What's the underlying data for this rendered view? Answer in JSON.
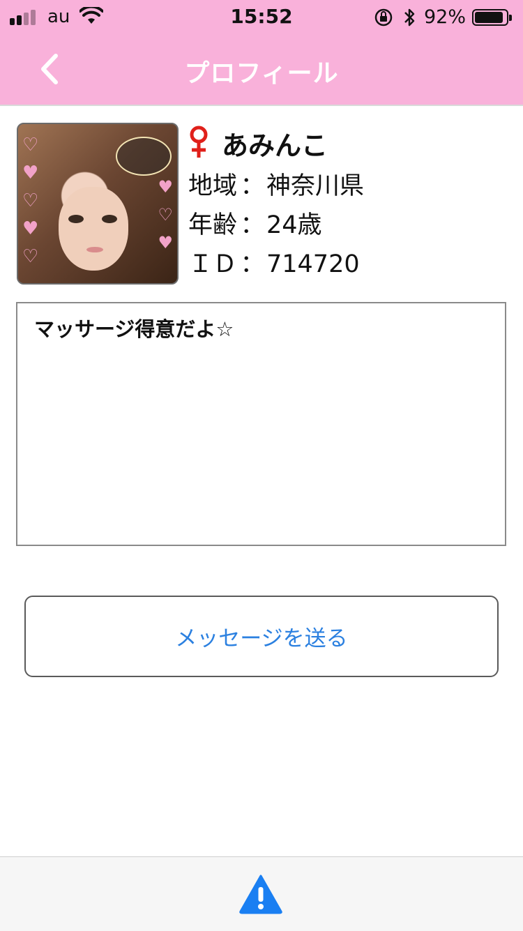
{
  "status_bar": {
    "carrier": "au",
    "time": "15:52",
    "battery_percent": "92%",
    "battery_level": 0.92,
    "signal_bars_filled": 2,
    "signal_bars_total": 4,
    "icons": [
      "signal-icon",
      "wifi-icon",
      "rotation-lock-icon",
      "bluetooth-icon",
      "battery-icon"
    ]
  },
  "nav": {
    "title": "プロフィール",
    "back_icon": "chevron-left-icon",
    "background_color": "#f9b1da"
  },
  "profile": {
    "gender_symbol": "♀",
    "gender_icon": "female-icon",
    "gender_color": "#e0201a",
    "name": "あみんこ",
    "region_label": "地域",
    "region_value": "神奈川県",
    "age_label": "年齢",
    "age_value": "24歳",
    "id_label": "ＩＤ",
    "id_value": "714720",
    "separator": "："
  },
  "bio": {
    "text": "マッサージ得意だよ☆"
  },
  "actions": {
    "send_message_label": "メッセージを送る",
    "send_message_color": "#2b80e0"
  },
  "bottom_bar": {
    "icon": "warning-icon",
    "icon_color": "#1a7ff2"
  }
}
